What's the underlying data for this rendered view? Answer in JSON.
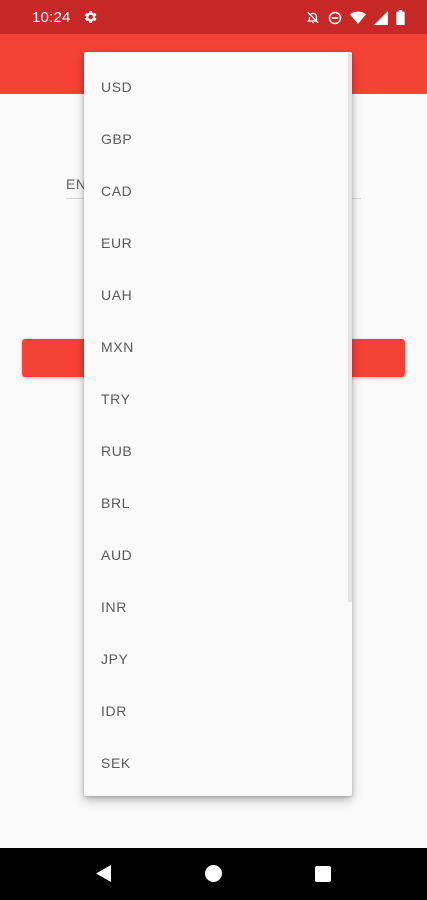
{
  "status_bar": {
    "time": "10:24",
    "icons": [
      "settings-icon",
      "notifications-off-icon",
      "do-not-disturb-icon",
      "wifi-icon",
      "signal-icon",
      "battery-icon"
    ]
  },
  "theme": {
    "primary": "#f44336",
    "primary_dark": "#c62828"
  },
  "main": {
    "input_hint": "EN"
  },
  "dropdown": {
    "items": [
      "USD",
      "GBP",
      "CAD",
      "EUR",
      "UAH",
      "MXN",
      "TRY",
      "RUB",
      "BRL",
      "AUD",
      "INR",
      "JPY",
      "IDR",
      "SEK"
    ]
  },
  "nav_bar": {
    "icons": [
      "back-icon",
      "home-icon",
      "recents-icon"
    ]
  }
}
